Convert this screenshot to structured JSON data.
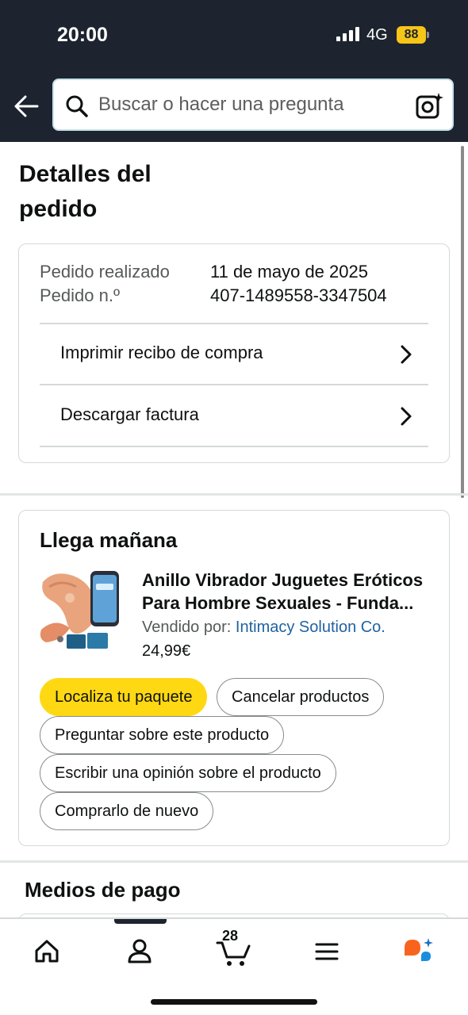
{
  "status_bar": {
    "time": "20:00",
    "network": "4G",
    "battery": "88"
  },
  "search": {
    "placeholder": "Buscar o hacer una pregunta"
  },
  "page": {
    "title": "Detalles del pedido"
  },
  "order": {
    "placed_label": "Pedido realizado",
    "placed_value": "11 de mayo de 2025",
    "number_label": "Pedido n.º",
    "number_value": "407-1489558-3347504",
    "links": [
      {
        "label": "Imprimir recibo de compra"
      },
      {
        "label": "Descargar factura"
      }
    ]
  },
  "shipment": {
    "status": "Llega mañana",
    "product": {
      "name": "Anillo Vibrador Juguetes Eróticos Para Hombre Sexuales - Funda...",
      "sold_by_label": "Vendido por:",
      "seller": "Intimacy Solution Co.",
      "price": "24,99€"
    },
    "actions": {
      "track": "Localiza tu paquete",
      "cancel": "Cancelar productos",
      "ask": "Preguntar sobre este producto",
      "review": "Escribir una opinión sobre el producto",
      "buy_again": "Comprarlo de nuevo"
    }
  },
  "payment": {
    "title": "Medios de pago"
  },
  "bottom_nav": {
    "items": [
      {
        "icon": "home-icon"
      },
      {
        "icon": "account-icon"
      },
      {
        "icon": "cart-icon"
      },
      {
        "icon": "menu-icon"
      },
      {
        "icon": "rufus-icon"
      }
    ],
    "cart_count": "28"
  },
  "colors": {
    "header_bg": "#1d2430",
    "primary_button": "#ffd814",
    "link": "#2162a1",
    "battery": "#f5c518"
  }
}
